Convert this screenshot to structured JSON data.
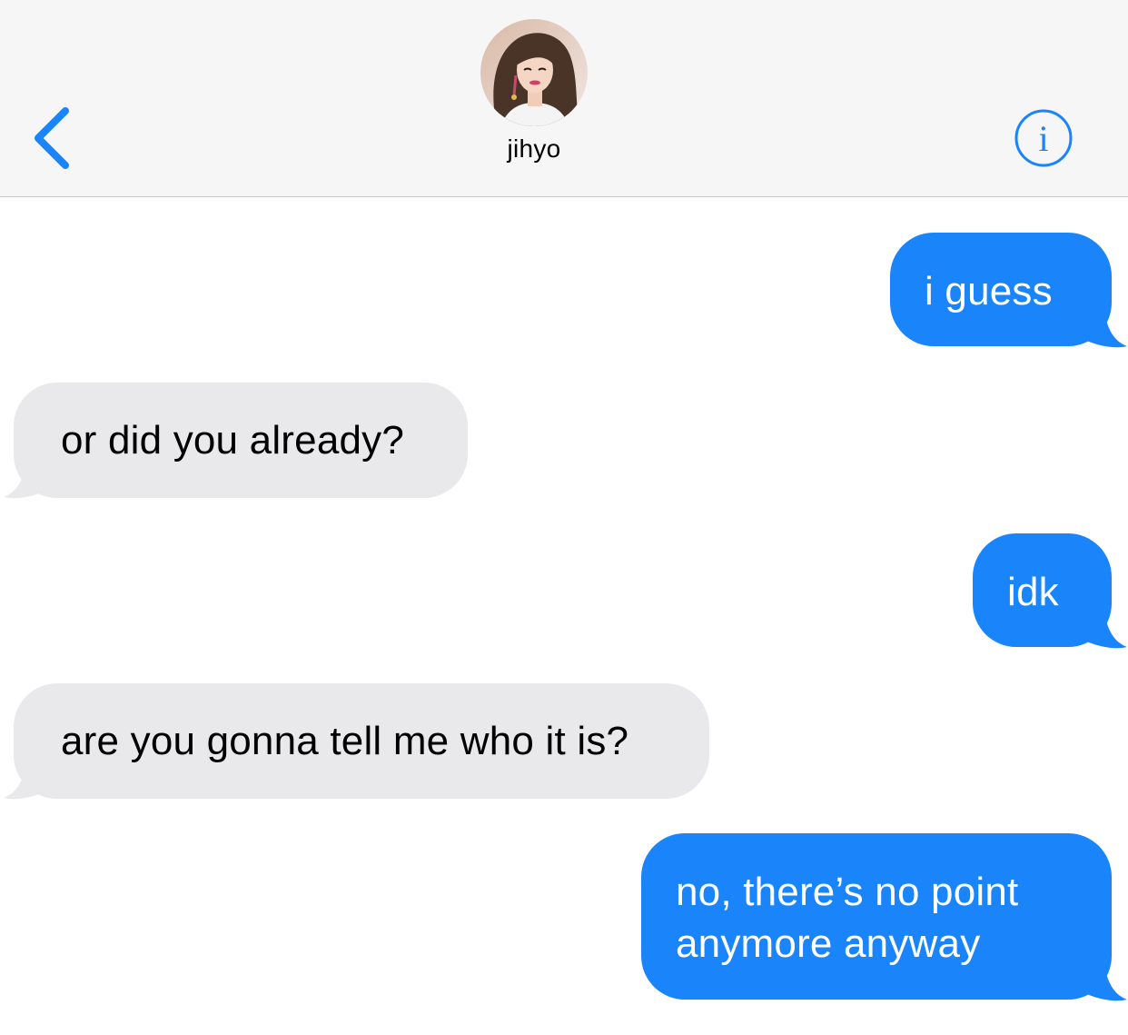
{
  "header": {
    "contact_name": "jihyo",
    "back_icon": "chevron-left-icon",
    "info_icon": "info-icon",
    "accent_color": "#1a84fb"
  },
  "messages": [
    {
      "side": "sent",
      "text": "i guess"
    },
    {
      "side": "received",
      "text": "or did you already?"
    },
    {
      "side": "sent",
      "text": "idk"
    },
    {
      "side": "received",
      "text": "are you gonna tell me who it is?"
    },
    {
      "side": "sent",
      "lines": [
        "no, there’s no point",
        "anymore anyway"
      ]
    }
  ],
  "colors": {
    "sent_bubble": "#1a84fb",
    "received_bubble": "#e9e9eb",
    "header_bg": "#f6f6f6"
  }
}
